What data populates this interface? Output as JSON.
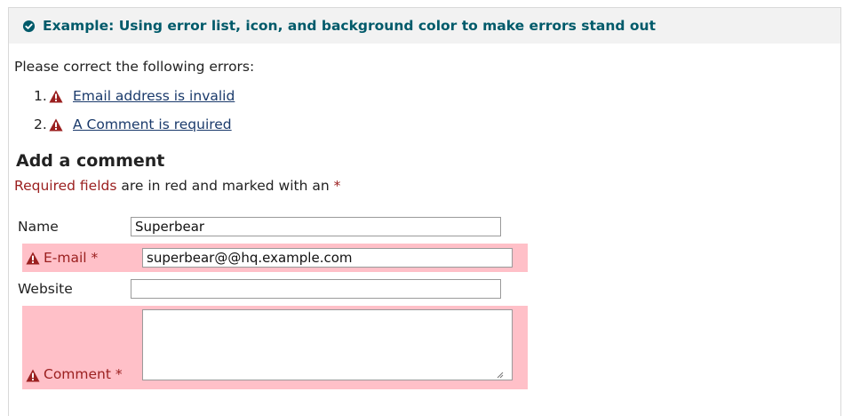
{
  "example": {
    "title": "Example: Using error list, icon, and background color to make errors stand out"
  },
  "errors": {
    "intro": "Please correct the following errors:",
    "items": [
      {
        "number": "1.",
        "text": "Email address is invalid"
      },
      {
        "number": "2.",
        "text": "A Comment is required"
      }
    ]
  },
  "form": {
    "heading": "Add a comment",
    "required_note_prefix": "Required fields",
    "required_note_suffix": " are in red and marked with an ",
    "required_marker": "*",
    "fields": {
      "name": {
        "label": "Name",
        "value": "Superbear"
      },
      "email": {
        "label": "E-mail *",
        "value": "superbear@@hq.example.com"
      },
      "website": {
        "label": "Website",
        "value": ""
      },
      "comment": {
        "label": "Comment *",
        "value": ""
      }
    }
  },
  "colors": {
    "accent": "#005a6a",
    "error_text": "#9b2020",
    "error_background": "#ffc0c8",
    "header_background": "#f2f2f2"
  },
  "icons": {
    "header": "check-circle-icon",
    "error": "warning-triangle-icon"
  }
}
